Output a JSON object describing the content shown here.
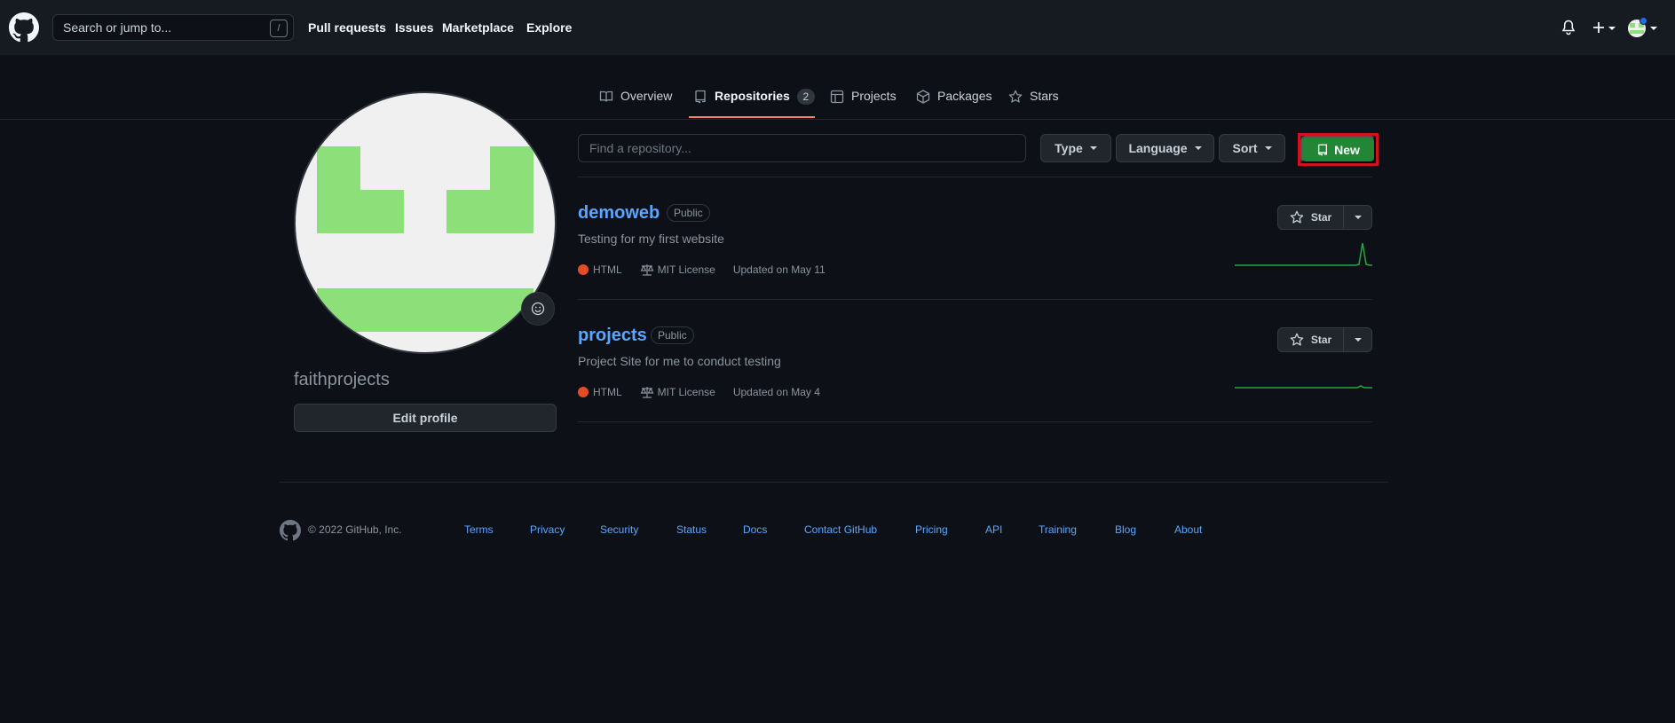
{
  "header": {
    "search_placeholder": "Search or jump to...",
    "slash_hint": "/",
    "nav": [
      "Pull requests",
      "Issues",
      "Marketplace",
      "Explore"
    ]
  },
  "tabs": {
    "overview": "Overview",
    "repositories": "Repositories",
    "repositories_count": "2",
    "projects": "Projects",
    "packages": "Packages",
    "stars": "Stars"
  },
  "profile": {
    "username": "faithprojects",
    "edit_label": "Edit profile"
  },
  "filters": {
    "find_placeholder": "Find a repository...",
    "type_label": "Type",
    "language_label": "Language",
    "sort_label": "Sort",
    "new_label": "New"
  },
  "repos": [
    {
      "name": "demoweb",
      "visibility": "Public",
      "description": "Testing for my first website",
      "language": "HTML",
      "license": "MIT License",
      "updated": "Updated on May 11",
      "star_label": "Star"
    },
    {
      "name": "projects",
      "visibility": "Public",
      "description": "Project Site for me to conduct testing",
      "language": "HTML",
      "license": "MIT License",
      "updated": "Updated on May 4",
      "star_label": "Star"
    }
  ],
  "footer": {
    "copyright": "© 2022 GitHub, Inc.",
    "links": [
      "Terms",
      "Privacy",
      "Security",
      "Status",
      "Docs",
      "Contact GitHub",
      "Pricing",
      "API",
      "Training",
      "Blog",
      "About"
    ]
  },
  "colors": {
    "accent_green": "#238636",
    "link_blue": "#58a6ff",
    "html_lang": "#e34c26",
    "highlight_red": "#d0121a",
    "avatar_green": "#8ddf7a"
  }
}
